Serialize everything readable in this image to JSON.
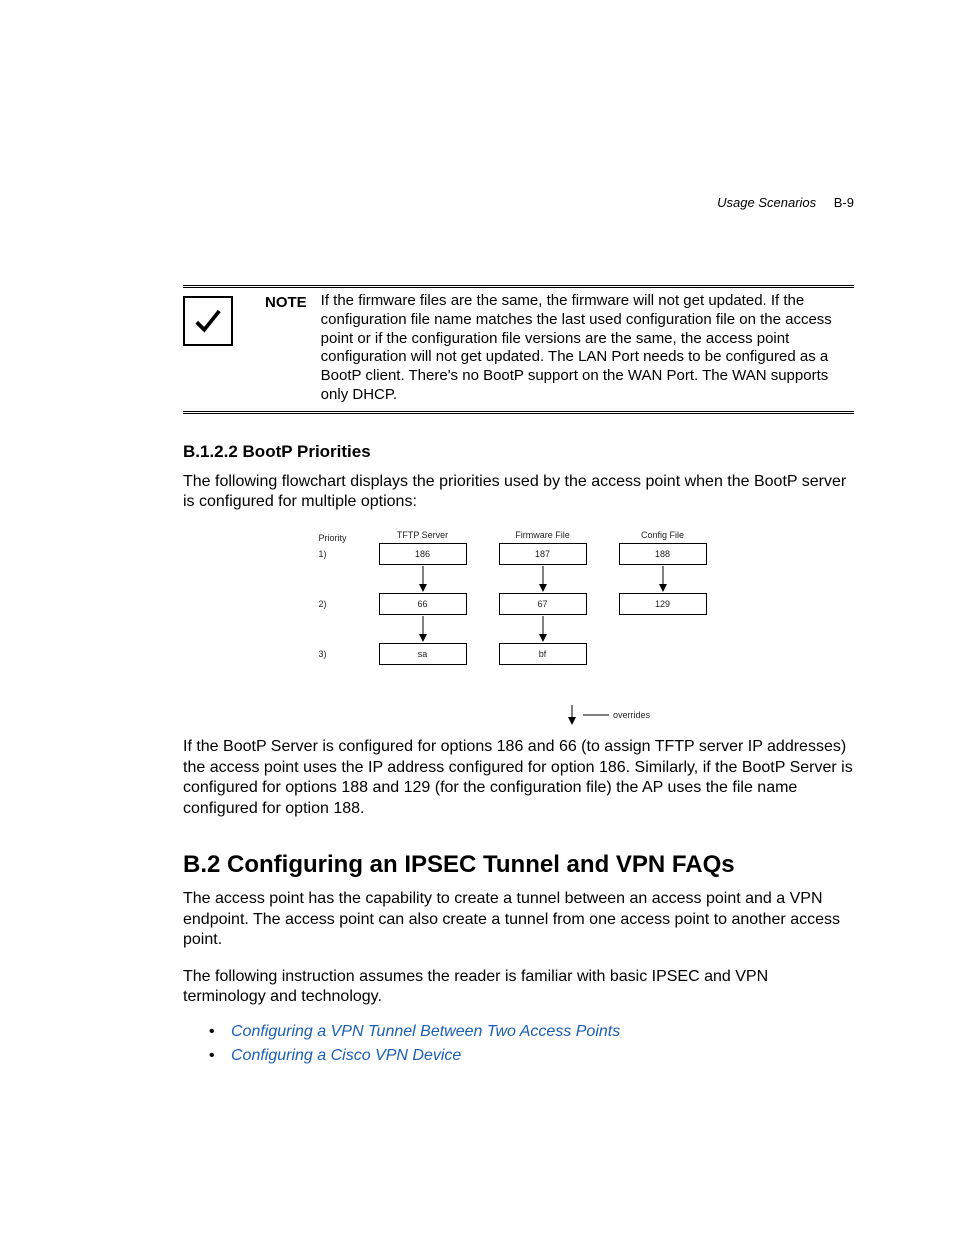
{
  "header": {
    "chapter": "Usage Scenarios",
    "page_num": "B-9"
  },
  "note": {
    "label": "NOTE",
    "text": "If the firmware files are the same, the firmware will not get updated. If the configuration file name matches the last used configuration file on the access point or if the configuration file versions are the same, the access point configuration will not get updated. The LAN Port needs to be configured as a BootP client. There's no BootP support on the WAN Port. The WAN supports only DHCP."
  },
  "section_b122": {
    "heading": "B.1.2.2  BootP Priorities",
    "intro": "The following flowchart displays the priorities used by the access point when the BootP server is configured for multiple options:",
    "after": "If the BootP Server is configured for options 186 and 66 (to assign TFTP server IP addresses) the access point uses the IP address configured for option 186. Similarly, if the BootP Server is configured for options 188 and 129 (for the configuration file) the AP uses the file name configured for option 188."
  },
  "chart_data": {
    "type": "table",
    "priority_header": "Priority",
    "columns": [
      "TFTP Server",
      "Firmware File",
      "Config File"
    ],
    "rows": [
      {
        "priority": "1)",
        "cells": [
          "186",
          "187",
          "188"
        ]
      },
      {
        "priority": "2)",
        "cells": [
          "66",
          "67",
          "129"
        ]
      },
      {
        "priority": "3)",
        "cells": [
          "sa",
          "bf",
          ""
        ]
      }
    ],
    "override_label": "overrides"
  },
  "section_b2": {
    "heading": "B.2  Configuring an IPSEC Tunnel and VPN FAQs",
    "p1": "The access point has the capability to create a tunnel between an access point and a VPN endpoint. The access point can also create a tunnel from one access point to another access point.",
    "p2": "The following instruction assumes the reader is familiar with basic IPSEC and VPN terminology and technology.",
    "links": [
      "Configuring a VPN Tunnel Between Two Access Points",
      "Configuring a Cisco VPN Device"
    ]
  }
}
